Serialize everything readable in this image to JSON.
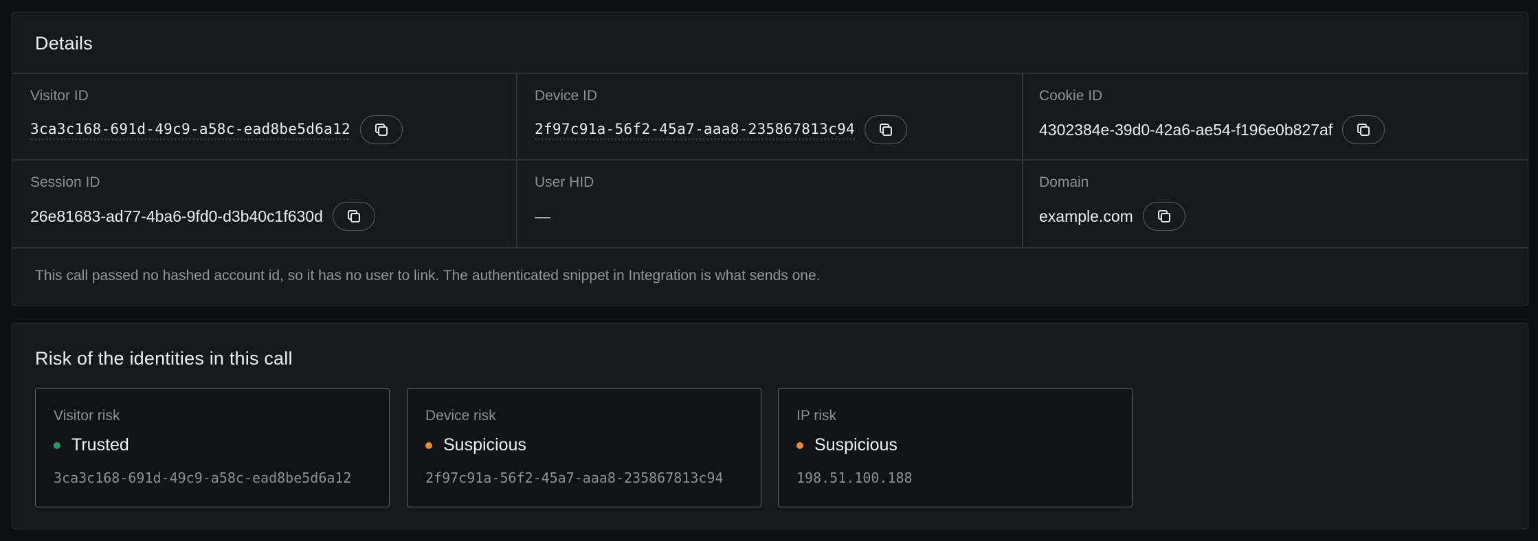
{
  "details": {
    "title": "Details",
    "fields": [
      {
        "label": "Visitor ID",
        "value": "3ca3c168-691d-49c9-a58c-ead8be5d6a12"
      },
      {
        "label": "Device ID",
        "value": "2f97c91a-56f2-45a7-aaa8-235867813c94"
      },
      {
        "label": "Cookie ID",
        "value": "4302384e-39d0-42a6-ae54-f196e0b827af"
      },
      {
        "label": "Session ID",
        "value": "26e81683-ad77-4ba6-9fd0-d3b40c1f630d"
      },
      {
        "label": "User HID",
        "value": "—"
      },
      {
        "label": "Domain",
        "value": "example.com"
      }
    ],
    "note": "This call passed no hashed account id, so it has no user to link. The authenticated snippet in Integration is what sends one."
  },
  "risk": {
    "title": "Risk of the identities in this call",
    "items": [
      {
        "label": "Visitor risk",
        "status": "Trusted",
        "status_color": "#22a06b",
        "id": "3ca3c168-691d-49c9-a58c-ead8be5d6a12"
      },
      {
        "label": "Device risk",
        "status": "Suspicious",
        "status_color": "#f0892a",
        "id": "2f97c91a-56f2-45a7-aaa8-235867813c94"
      },
      {
        "label": "IP risk",
        "status": "Suspicious",
        "status_color": "#f0892a",
        "id": "198.51.100.188"
      }
    ]
  },
  "icons": {
    "copy": "copy-icon"
  }
}
